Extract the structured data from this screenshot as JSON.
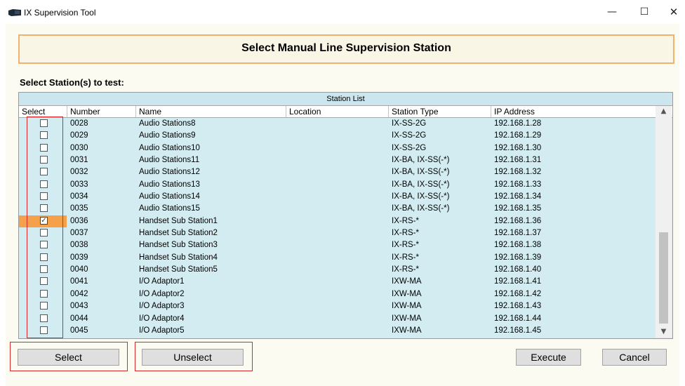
{
  "window": {
    "title": "IX Supervision Tool",
    "minimize": "—",
    "maximize": "☐",
    "close": "✕"
  },
  "header": {
    "title": "Select Manual Line Supervision Station"
  },
  "select_label": "Select Station(s) to test:",
  "grid": {
    "caption": "Station List",
    "columns": [
      "Select",
      "Number",
      "Name",
      "Location",
      "Station Type",
      "IP Address"
    ],
    "rows": [
      {
        "number": "0028",
        "name": "Audio Stations8",
        "location": "",
        "type": "IX-SS-2G",
        "ip": "192.168.1.28",
        "checked": false
      },
      {
        "number": "0029",
        "name": "Audio Stations9",
        "location": "",
        "type": "IX-SS-2G",
        "ip": "192.168.1.29",
        "checked": false
      },
      {
        "number": "0030",
        "name": "Audio Stations10",
        "location": "",
        "type": "IX-SS-2G",
        "ip": "192.168.1.30",
        "checked": false
      },
      {
        "number": "0031",
        "name": "Audio Stations11",
        "location": "",
        "type": "IX-BA, IX-SS(-*)",
        "ip": "192.168.1.31",
        "checked": false
      },
      {
        "number": "0032",
        "name": "Audio Stations12",
        "location": "",
        "type": "IX-BA, IX-SS(-*)",
        "ip": "192.168.1.32",
        "checked": false
      },
      {
        "number": "0033",
        "name": "Audio Stations13",
        "location": "",
        "type": "IX-BA, IX-SS(-*)",
        "ip": "192.168.1.33",
        "checked": false
      },
      {
        "number": "0034",
        "name": "Audio Stations14",
        "location": "",
        "type": "IX-BA, IX-SS(-*)",
        "ip": "192.168.1.34",
        "checked": false
      },
      {
        "number": "0035",
        "name": "Audio Stations15",
        "location": "",
        "type": "IX-BA, IX-SS(-*)",
        "ip": "192.168.1.35",
        "checked": false
      },
      {
        "number": "0036",
        "name": "Handset Sub Station1",
        "location": "",
        "type": "IX-RS-*",
        "ip": "192.168.1.36",
        "checked": true
      },
      {
        "number": "0037",
        "name": "Handset Sub Station2",
        "location": "",
        "type": "IX-RS-*",
        "ip": "192.168.1.37",
        "checked": false
      },
      {
        "number": "0038",
        "name": "Handset Sub Station3",
        "location": "",
        "type": "IX-RS-*",
        "ip": "192.168.1.38",
        "checked": false
      },
      {
        "number": "0039",
        "name": "Handset Sub Station4",
        "location": "",
        "type": "IX-RS-*",
        "ip": "192.168.1.39",
        "checked": false
      },
      {
        "number": "0040",
        "name": "Handset Sub Station5",
        "location": "",
        "type": "IX-RS-*",
        "ip": "192.168.1.40",
        "checked": false
      },
      {
        "number": "0041",
        "name": "I/O Adaptor1",
        "location": "",
        "type": "IXW-MA",
        "ip": "192.168.1.41",
        "checked": false
      },
      {
        "number": "0042",
        "name": "I/O Adaptor2",
        "location": "",
        "type": "IXW-MA",
        "ip": "192.168.1.42",
        "checked": false
      },
      {
        "number": "0043",
        "name": "I/O Adaptor3",
        "location": "",
        "type": "IXW-MA",
        "ip": "192.168.1.43",
        "checked": false
      },
      {
        "number": "0044",
        "name": "I/O Adaptor4",
        "location": "",
        "type": "IXW-MA",
        "ip": "192.168.1.44",
        "checked": false
      },
      {
        "number": "0045",
        "name": "I/O Adaptor5",
        "location": "",
        "type": "IXW-MA",
        "ip": "192.168.1.45",
        "checked": false
      }
    ],
    "scroll_up": "▲",
    "scroll_down": "▼"
  },
  "buttons": {
    "select": "Select",
    "unselect": "Unselect",
    "execute": "Execute",
    "cancel": "Cancel"
  },
  "colors": {
    "header_border": "#f0b26c",
    "row_background": "#d3ecf1",
    "selected_cell": "#f5a04a",
    "highlight_box": "#d42a2a"
  }
}
